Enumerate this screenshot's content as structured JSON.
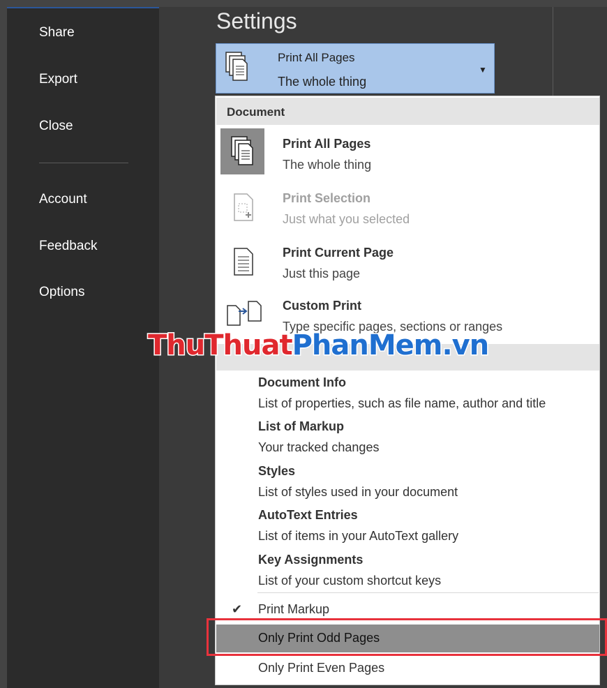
{
  "sidebar": {
    "items": [
      {
        "label": "Share"
      },
      {
        "label": "Export"
      },
      {
        "label": "Close"
      },
      {
        "label": "Account"
      },
      {
        "label": "Feedback"
      },
      {
        "label": "Options"
      }
    ]
  },
  "settings": {
    "title": "Settings",
    "dropdown": {
      "title": "Print All Pages",
      "subtitle": "The whole thing",
      "icon": "multi-page-icon"
    }
  },
  "menu": {
    "document_header": "Document",
    "items": [
      {
        "title": "Print All Pages",
        "subtitle": "The whole thing",
        "icon": "multi-page-icon",
        "selected": true
      },
      {
        "title": "Print Selection",
        "subtitle": "Just what you selected",
        "icon": "selection-page-icon",
        "disabled": true
      },
      {
        "title": "Print Current Page",
        "subtitle": "Just this page",
        "icon": "single-page-icon"
      },
      {
        "title": "Custom Print",
        "subtitle": "Type specific pages, sections or ranges",
        "icon": "custom-print-icon"
      }
    ],
    "info_items": [
      {
        "title": "Document Info",
        "subtitle": "List of properties, such as file name, author and title"
      },
      {
        "title": "List of Markup",
        "subtitle": "Your tracked changes"
      },
      {
        "title": "Styles",
        "subtitle": "List of styles used in your document"
      },
      {
        "title": "AutoText Entries",
        "subtitle": "List of items in your AutoText gallery"
      },
      {
        "title": "Key Assignments",
        "subtitle": "List of your custom shortcut keys"
      }
    ],
    "options": [
      {
        "label": "Print Markup",
        "checked": true
      },
      {
        "label": "Only Print Odd Pages",
        "hover": true
      },
      {
        "label": "Only Print Even Pages"
      }
    ]
  },
  "watermark": {
    "part1": "ThuThuat",
    "part2": "PhanMem.vn"
  },
  "colors": {
    "accent": "#2b579a",
    "dropdown_bg": "#a9c6ea",
    "highlight_border": "#e8323c"
  }
}
